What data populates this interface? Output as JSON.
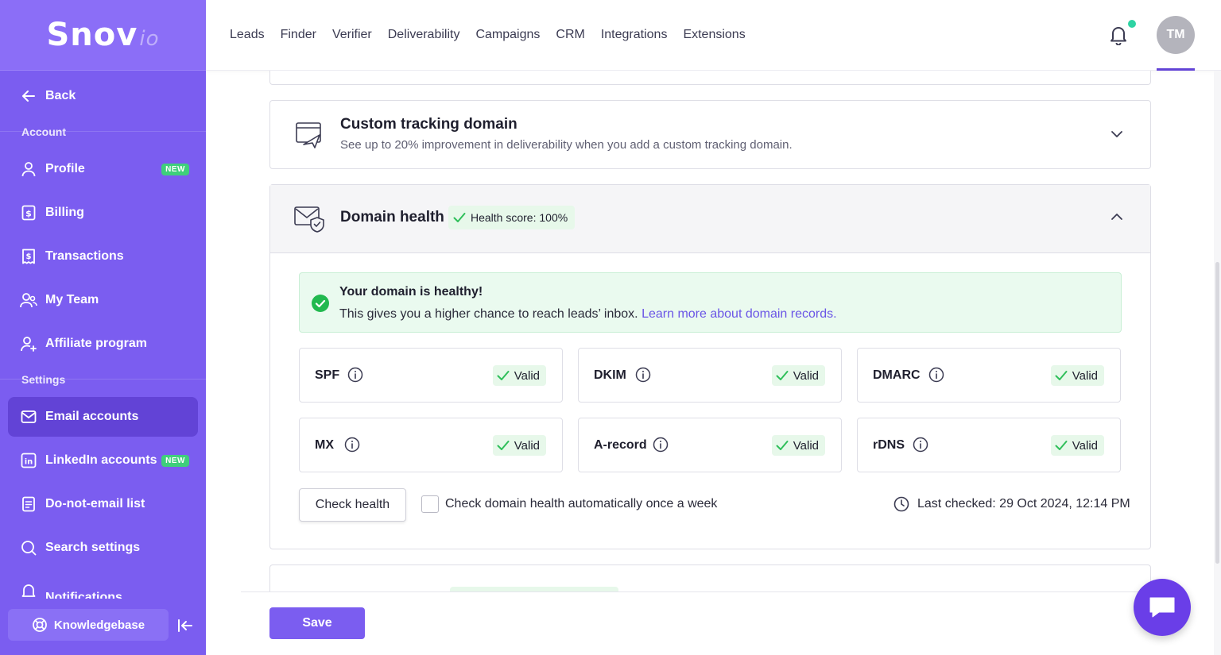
{
  "brand": {
    "name": "Snov",
    "suffix": "io"
  },
  "sidebar": {
    "back_label": "Back",
    "account_label": "Account",
    "settings_label": "Settings",
    "items": [
      {
        "label": "Profile",
        "badge": "NEW"
      },
      {
        "label": "Billing"
      },
      {
        "label": "Transactions"
      },
      {
        "label": "My Team"
      },
      {
        "label": "Affiliate program"
      },
      {
        "label": "Email accounts"
      },
      {
        "label": "LinkedIn accounts",
        "badge": "NEW"
      },
      {
        "label": "Do-not-email list"
      },
      {
        "label": "Search settings"
      },
      {
        "label": "Notifications"
      }
    ],
    "knowledgebase_label": "Knowledgebase"
  },
  "topnav": {
    "items": [
      "Leads",
      "Finder",
      "Verifier",
      "Deliverability",
      "Campaigns",
      "CRM",
      "Integrations",
      "Extensions"
    ],
    "avatar_initials": "TM"
  },
  "tracking": {
    "title": "Custom tracking domain",
    "subtitle": "See up to 20% improvement in deliverability when you add a custom tracking domain."
  },
  "health": {
    "title": "Domain health",
    "score_label": "Health score: 100%",
    "healthy_title": "Your domain is healthy!",
    "healthy_text": "This gives you a higher chance to reach leads’ inbox.",
    "healthy_link": "Learn more about domain records.",
    "records": [
      {
        "name": "SPF",
        "status": "Valid"
      },
      {
        "name": "DKIM",
        "status": "Valid"
      },
      {
        "name": "DMARC",
        "status": "Valid"
      },
      {
        "name": "MX",
        "status": "Valid"
      },
      {
        "name": "A-record",
        "status": "Valid"
      },
      {
        "name": "rDNS",
        "status": "Valid"
      }
    ],
    "check_button": "Check health",
    "auto_check_label": "Check domain health automatically once a week",
    "auto_check_checked": false,
    "last_checked": "Last checked: 29 Oct 2024, 12:14 PM"
  },
  "footer": {
    "save_label": "Save"
  },
  "colors": {
    "primary": "#7b5df0",
    "active": "#6243d6",
    "success": "#2fbf5a",
    "link": "#6a55e6"
  }
}
